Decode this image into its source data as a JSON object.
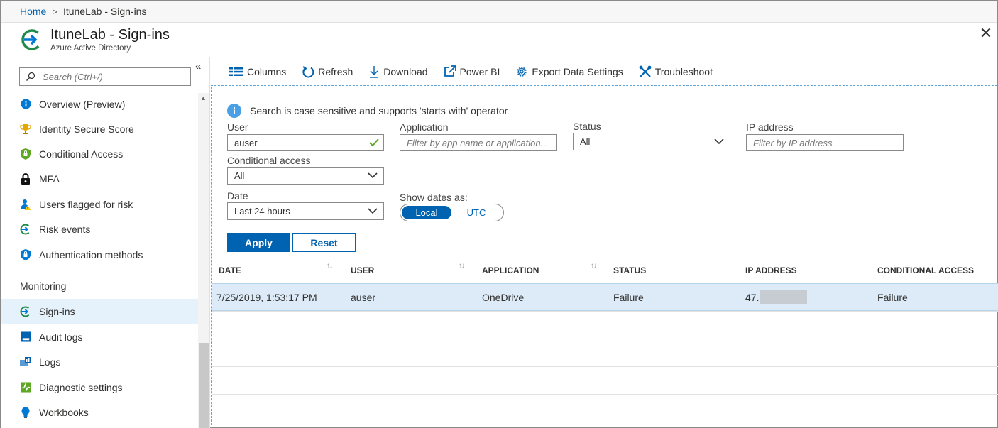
{
  "breadcrumb": {
    "home": "Home",
    "separator": ">",
    "current": "ItuneLab - Sign-ins"
  },
  "header": {
    "title": "ItuneLab - Sign-ins",
    "subtitle": "Azure Active Directory",
    "close_icon": "close-icon"
  },
  "sidebar": {
    "search_placeholder": "Search (Ctrl+/)",
    "collapse_label": "«",
    "items": [
      {
        "label": "Overview (Preview)",
        "icon": "info-icon",
        "color": "#0078d4"
      },
      {
        "label": "Identity Secure Score",
        "icon": "trophy-icon",
        "color": "#d8a200"
      },
      {
        "label": "Conditional Access",
        "icon": "shield-icon",
        "color": "#5ea823"
      },
      {
        "label": "MFA",
        "icon": "lock-icon",
        "color": "#111111"
      },
      {
        "label": "Users flagged for risk",
        "icon": "user-warning-icon",
        "color": "#0078d4"
      },
      {
        "label": "Risk events",
        "icon": "signin-arrow-icon",
        "color": "#1e8a4a"
      },
      {
        "label": "Authentication methods",
        "icon": "shield-lock-icon",
        "color": "#0078d4"
      }
    ],
    "section_label": "Monitoring",
    "monitoring_items": [
      {
        "label": "Sign-ins",
        "icon": "signin-arrow-icon",
        "active": true
      },
      {
        "label": "Audit logs",
        "icon": "audit-log-icon"
      },
      {
        "label": "Logs",
        "icon": "logs-icon"
      },
      {
        "label": "Diagnostic settings",
        "icon": "diagnostic-icon"
      },
      {
        "label": "Workbooks",
        "icon": "workbook-bulb-icon"
      }
    ]
  },
  "toolbar": {
    "columns": "Columns",
    "refresh": "Refresh",
    "download": "Download",
    "powerbi": "Power BI",
    "export": "Export Data Settings",
    "troubleshoot": "Troubleshoot"
  },
  "filters": {
    "info_text": "Search is case sensitive and supports 'starts with' operator",
    "user_label": "User",
    "user_value": "auser",
    "application_label": "Application",
    "application_placeholder": "Filter by app name or application...",
    "status_label": "Status",
    "status_value": "All",
    "ip_label": "IP address",
    "ip_placeholder": "Filter by IP address",
    "ca_label": "Conditional access",
    "ca_value": "All",
    "date_label": "Date",
    "date_value": "Last 24 hours",
    "show_dates_label": "Show dates as:",
    "toggle_local": "Local",
    "toggle_utc": "UTC",
    "apply": "Apply",
    "reset": "Reset"
  },
  "table": {
    "columns": [
      "DATE",
      "USER",
      "APPLICATION",
      "STATUS",
      "IP ADDRESS",
      "CONDITIONAL ACCESS"
    ],
    "rows": [
      {
        "date": "7/25/2019, 1:53:17 PM",
        "user": "auser",
        "application": "OneDrive",
        "status": "Failure",
        "ip": "47.",
        "conditional_access": "Failure"
      }
    ]
  },
  "colors": {
    "accent": "#0063b1",
    "selected_row": "#dcebf7",
    "active_nav": "#e5f1fb"
  }
}
